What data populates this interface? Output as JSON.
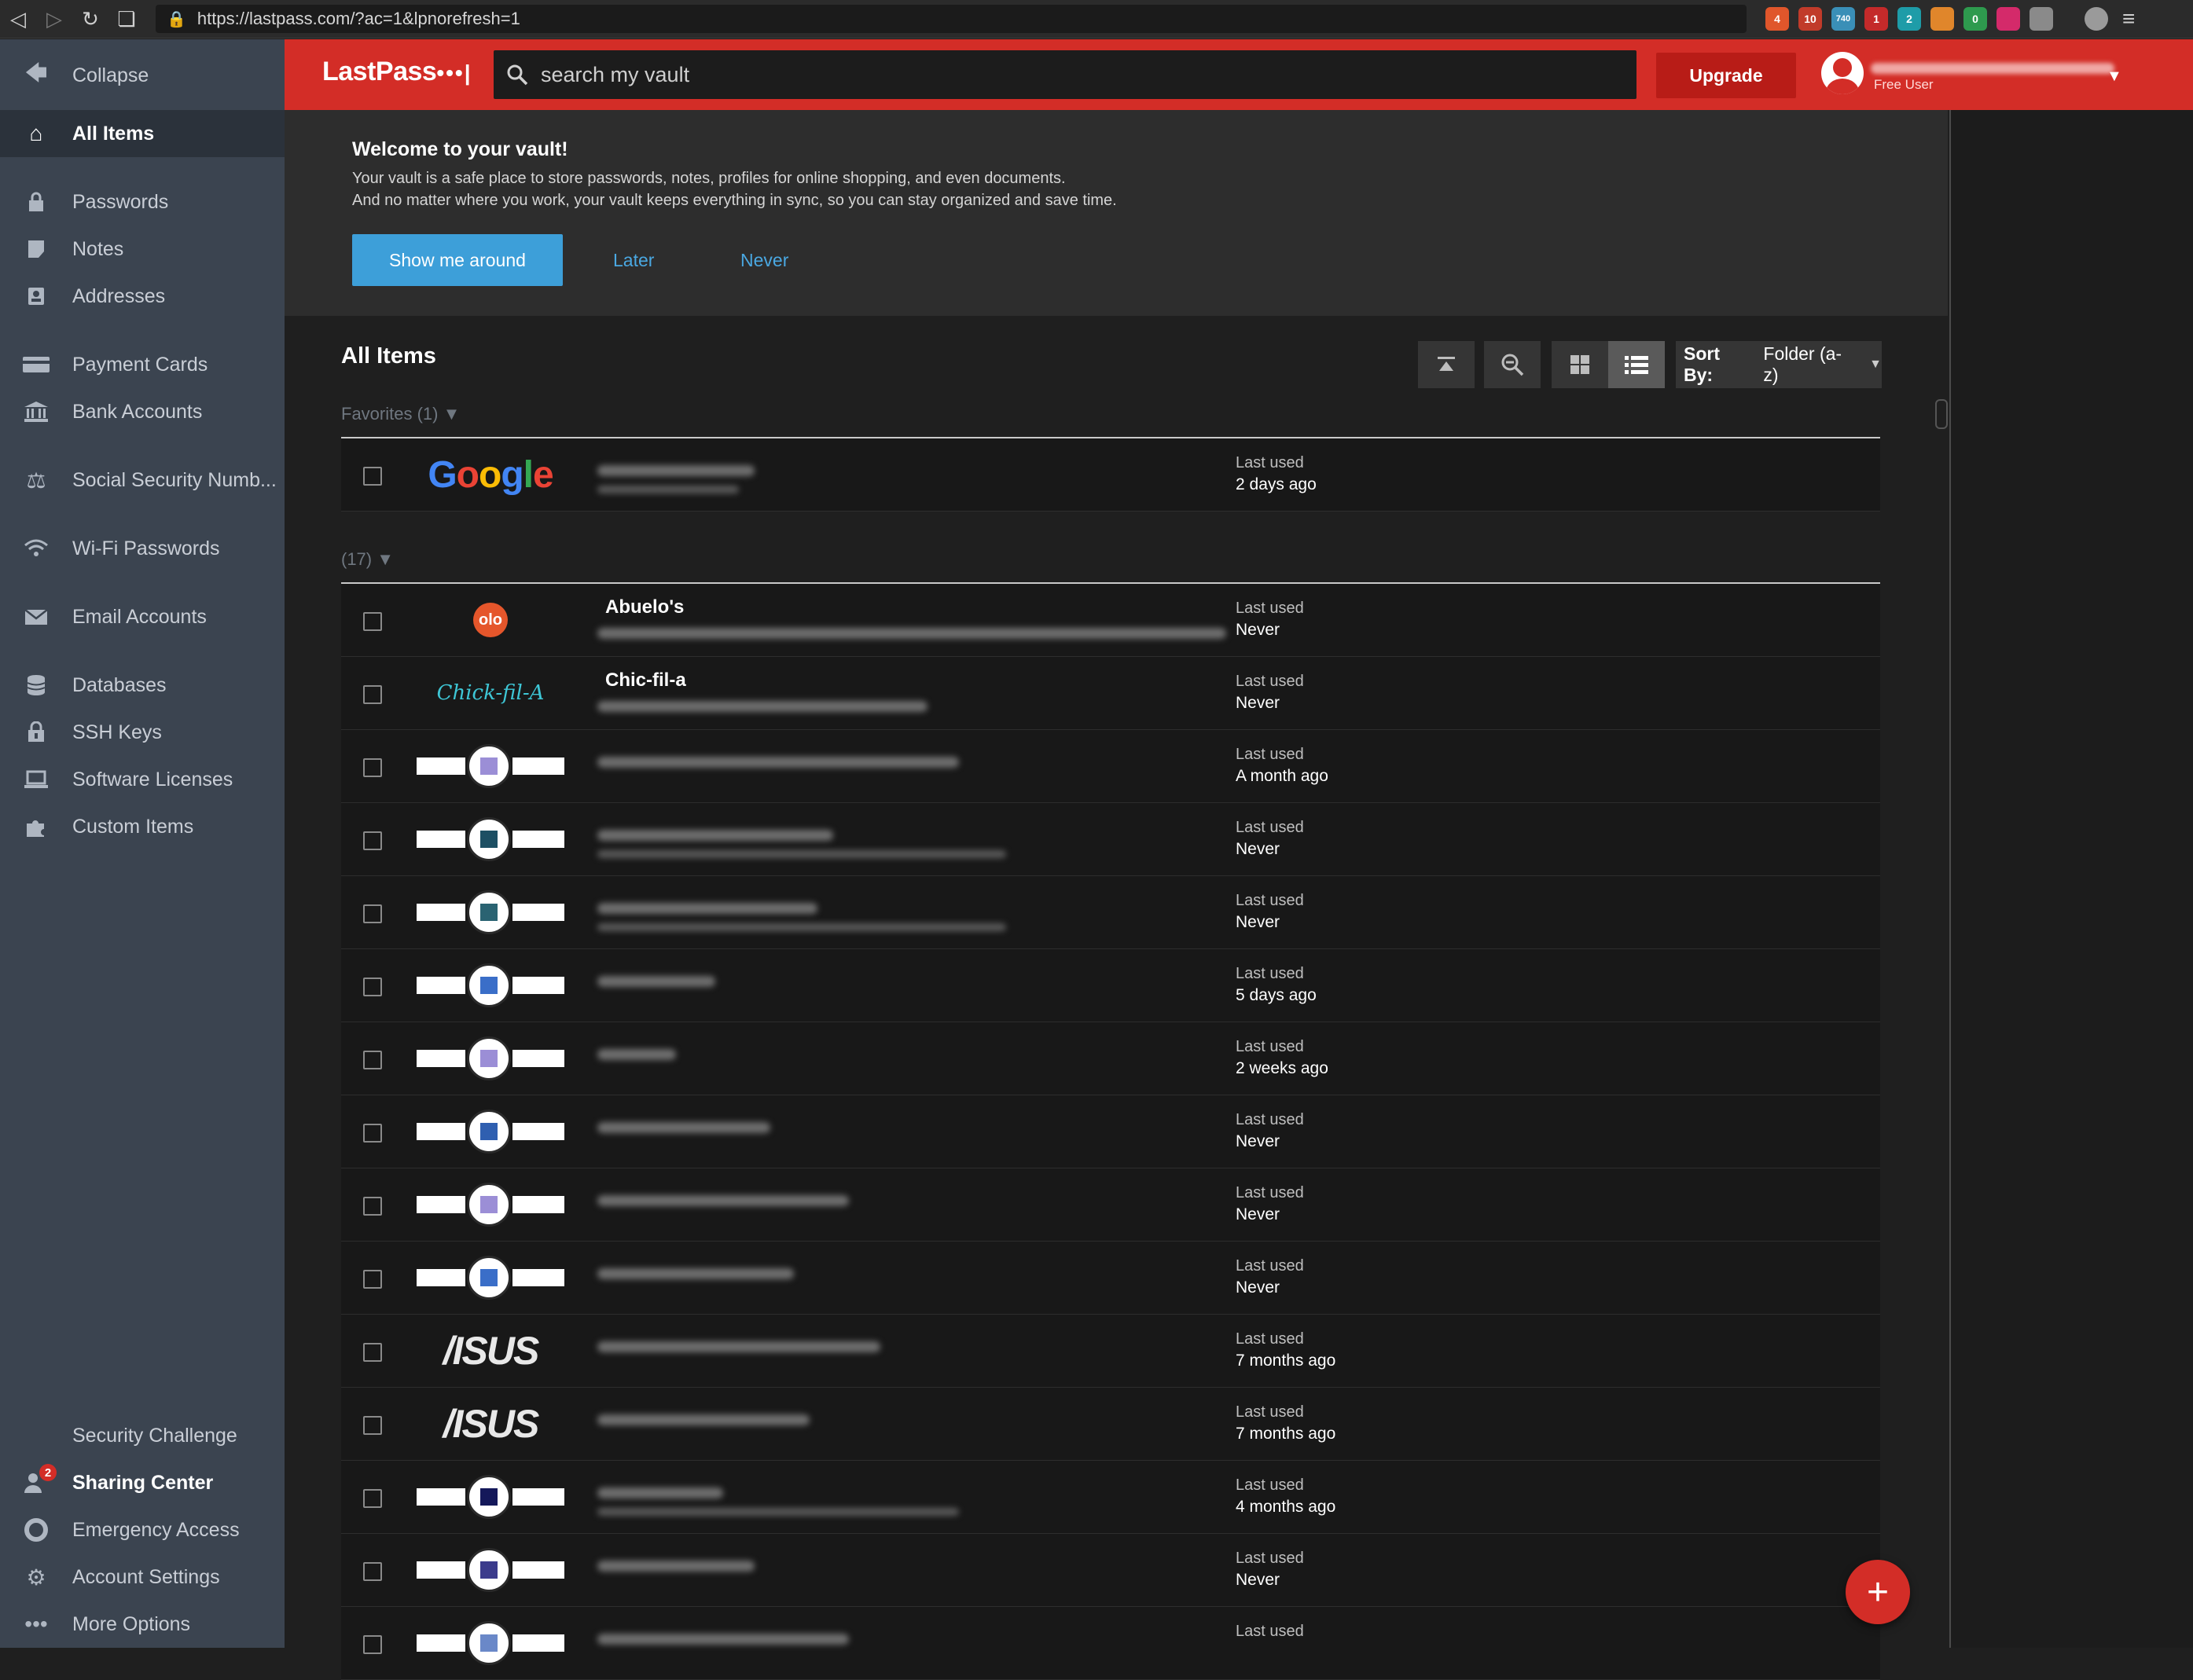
{
  "browser": {
    "url": "https://lastpass.com/?ac=1&lpnorefresh=1",
    "ext_badges": [
      "4",
      "10",
      "740",
      "1",
      "2",
      "0"
    ]
  },
  "sidebar": {
    "collapse": "Collapse",
    "all_items": "All Items",
    "items": [
      {
        "label": "Passwords",
        "icon": "lock-icon"
      },
      {
        "label": "Notes",
        "icon": "note-icon"
      },
      {
        "label": "Addresses",
        "icon": "address-icon"
      },
      {
        "label": "Payment Cards",
        "icon": "card-icon"
      },
      {
        "label": "Bank Accounts",
        "icon": "bank-icon"
      },
      {
        "label": "Social Security Numb...",
        "icon": "scales-icon"
      },
      {
        "label": "Wi-Fi Passwords",
        "icon": "wifi-icon"
      },
      {
        "label": "Email Accounts",
        "icon": "envelope-icon"
      },
      {
        "label": "Databases",
        "icon": "database-icon"
      },
      {
        "label": "SSH Keys",
        "icon": "key-icon"
      },
      {
        "label": "Software Licenses",
        "icon": "laptop-icon"
      },
      {
        "label": "Custom Items",
        "icon": "puzzle-icon"
      }
    ],
    "bottom": {
      "security_challenge": "Security Challenge",
      "sharing_center": "Sharing Center",
      "sharing_badge": "2",
      "emergency_access": "Emergency Access",
      "account_settings": "Account Settings",
      "more_options": "More Options"
    }
  },
  "header": {
    "logo": "LastPass",
    "logo_dots": "•••|",
    "search_placeholder": "search my vault",
    "upgrade": "Upgrade",
    "user_status": "Free User"
  },
  "welcome": {
    "title": "Welcome to your vault!",
    "line1": "Your vault is a safe place to store passwords, notes, profiles for online shopping, and even documents.",
    "line2": "And no matter where you work, your vault keeps everything in sync, so you can stay organized and save time.",
    "show_me": "Show me around",
    "later": "Later",
    "never": "Never"
  },
  "items_panel": {
    "title": "All Items",
    "sort_label": "Sort By:",
    "sort_value": "Folder (a-z)",
    "favorites_group": "Favorites (1) ▼",
    "folder_group": "(17) ▼",
    "last_used_label": "Last used"
  },
  "favorites": [
    {
      "logo": "Google",
      "last_used": "2 days ago"
    }
  ],
  "rows": [
    {
      "logo": "olo",
      "logo_text": "olo",
      "name": "Abuelo's",
      "last_used": "Never"
    },
    {
      "logo": "chickfila",
      "logo_text": "Chick-fil-A",
      "name": "Chic-fil-a",
      "last_used": "Never"
    },
    {
      "logo": "placeholder",
      "color": "#9b8ed6",
      "name": "",
      "last_used": "A month ago"
    },
    {
      "logo": "placeholder",
      "color": "#1d4f63",
      "name": "",
      "last_used": "Never"
    },
    {
      "logo": "placeholder",
      "color": "#2a6372",
      "name": "",
      "last_used": "Never"
    },
    {
      "logo": "placeholder",
      "color": "#3a6ec8",
      "name": "",
      "last_used": "5 days ago"
    },
    {
      "logo": "placeholder",
      "color": "#9b8ed6",
      "name": "",
      "last_used": "2 weeks ago"
    },
    {
      "logo": "placeholder",
      "color": "#2f5fb0",
      "name": "",
      "last_used": "Never"
    },
    {
      "logo": "placeholder",
      "color": "#9b8ed6",
      "name": "",
      "last_used": "Never"
    },
    {
      "logo": "placeholder",
      "color": "#3a6ec8",
      "name": "",
      "last_used": "Never"
    },
    {
      "logo": "asus",
      "logo_text": "/ISUS",
      "name": "",
      "last_used": "7 months ago"
    },
    {
      "logo": "asus",
      "logo_text": "/ISUS",
      "name": "",
      "last_used": "7 months ago"
    },
    {
      "logo": "placeholder",
      "color": "#14185a",
      "name": "",
      "last_used": "4 months ago"
    },
    {
      "logo": "placeholder",
      "color": "#3b3b8c",
      "name": "",
      "last_used": "Never"
    },
    {
      "logo": "placeholder",
      "color": "#6a88c8",
      "name": "",
      "last_used": ""
    }
  ],
  "fab": "+"
}
